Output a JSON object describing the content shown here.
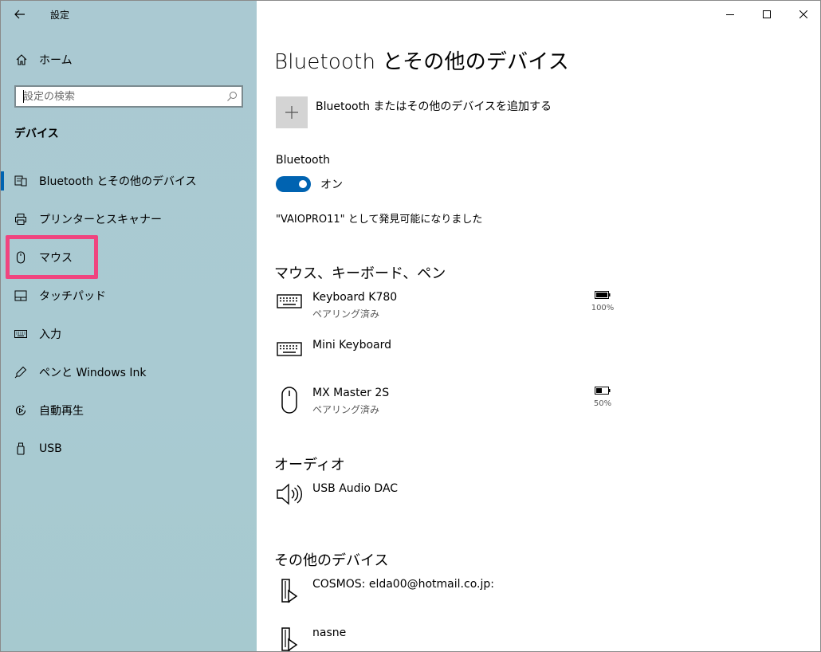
{
  "app": {
    "title": "設定"
  },
  "sidebar": {
    "home_label": "ホーム",
    "search_placeholder": "設定の検索",
    "section_title": "デバイス",
    "items": [
      {
        "label": "Bluetooth とその他のデバイス",
        "icon": "bluetooth-devices-icon",
        "active": true
      },
      {
        "label": "プリンターとスキャナー",
        "icon": "printer-icon"
      },
      {
        "label": "マウス",
        "icon": "mouse-icon"
      },
      {
        "label": "タッチパッド",
        "icon": "touchpad-icon"
      },
      {
        "label": "入力",
        "icon": "keyboard-icon"
      },
      {
        "label": "ペンと Windows Ink",
        "icon": "pen-icon"
      },
      {
        "label": "自動再生",
        "icon": "autoplay-icon"
      },
      {
        "label": "USB",
        "icon": "usb-icon"
      }
    ],
    "highlight_color": "#f0447f"
  },
  "main": {
    "page_title": "Bluetooth とその他のデバイス",
    "add_device_label": "Bluetooth またはその他のデバイスを追加する",
    "bluetooth_label": "Bluetooth",
    "toggle_state": "オン",
    "discoverable_text": "\"VAIOPRO11\" として発見可能になりました",
    "groups": {
      "input": {
        "title": "マウス、キーボード、ペン",
        "devices": [
          {
            "name": "Keyboard K780",
            "status": "ペアリング済み",
            "battery": "100%",
            "battery_level": 1.0,
            "icon": "keyboard-icon"
          },
          {
            "name": "Mini Keyboard",
            "status": "",
            "icon": "keyboard-icon"
          },
          {
            "name": "MX Master 2S",
            "status": "ペアリング済み",
            "battery": "50%",
            "battery_level": 0.5,
            "icon": "mouse-icon"
          }
        ]
      },
      "audio": {
        "title": "オーディオ",
        "devices": [
          {
            "name": "USB Audio DAC",
            "icon": "speaker-icon"
          }
        ]
      },
      "other": {
        "title": "その他のデバイス",
        "devices": [
          {
            "name": "COSMOS: elda00@hotmail.co.jp:",
            "icon": "media-device-icon"
          },
          {
            "name": "nasne",
            "icon": "media-device-icon"
          }
        ]
      }
    }
  },
  "colors": {
    "accent": "#0063b1",
    "sidebar_bg": "#aac9d2",
    "add_box_bg": "#d4d4d4"
  }
}
